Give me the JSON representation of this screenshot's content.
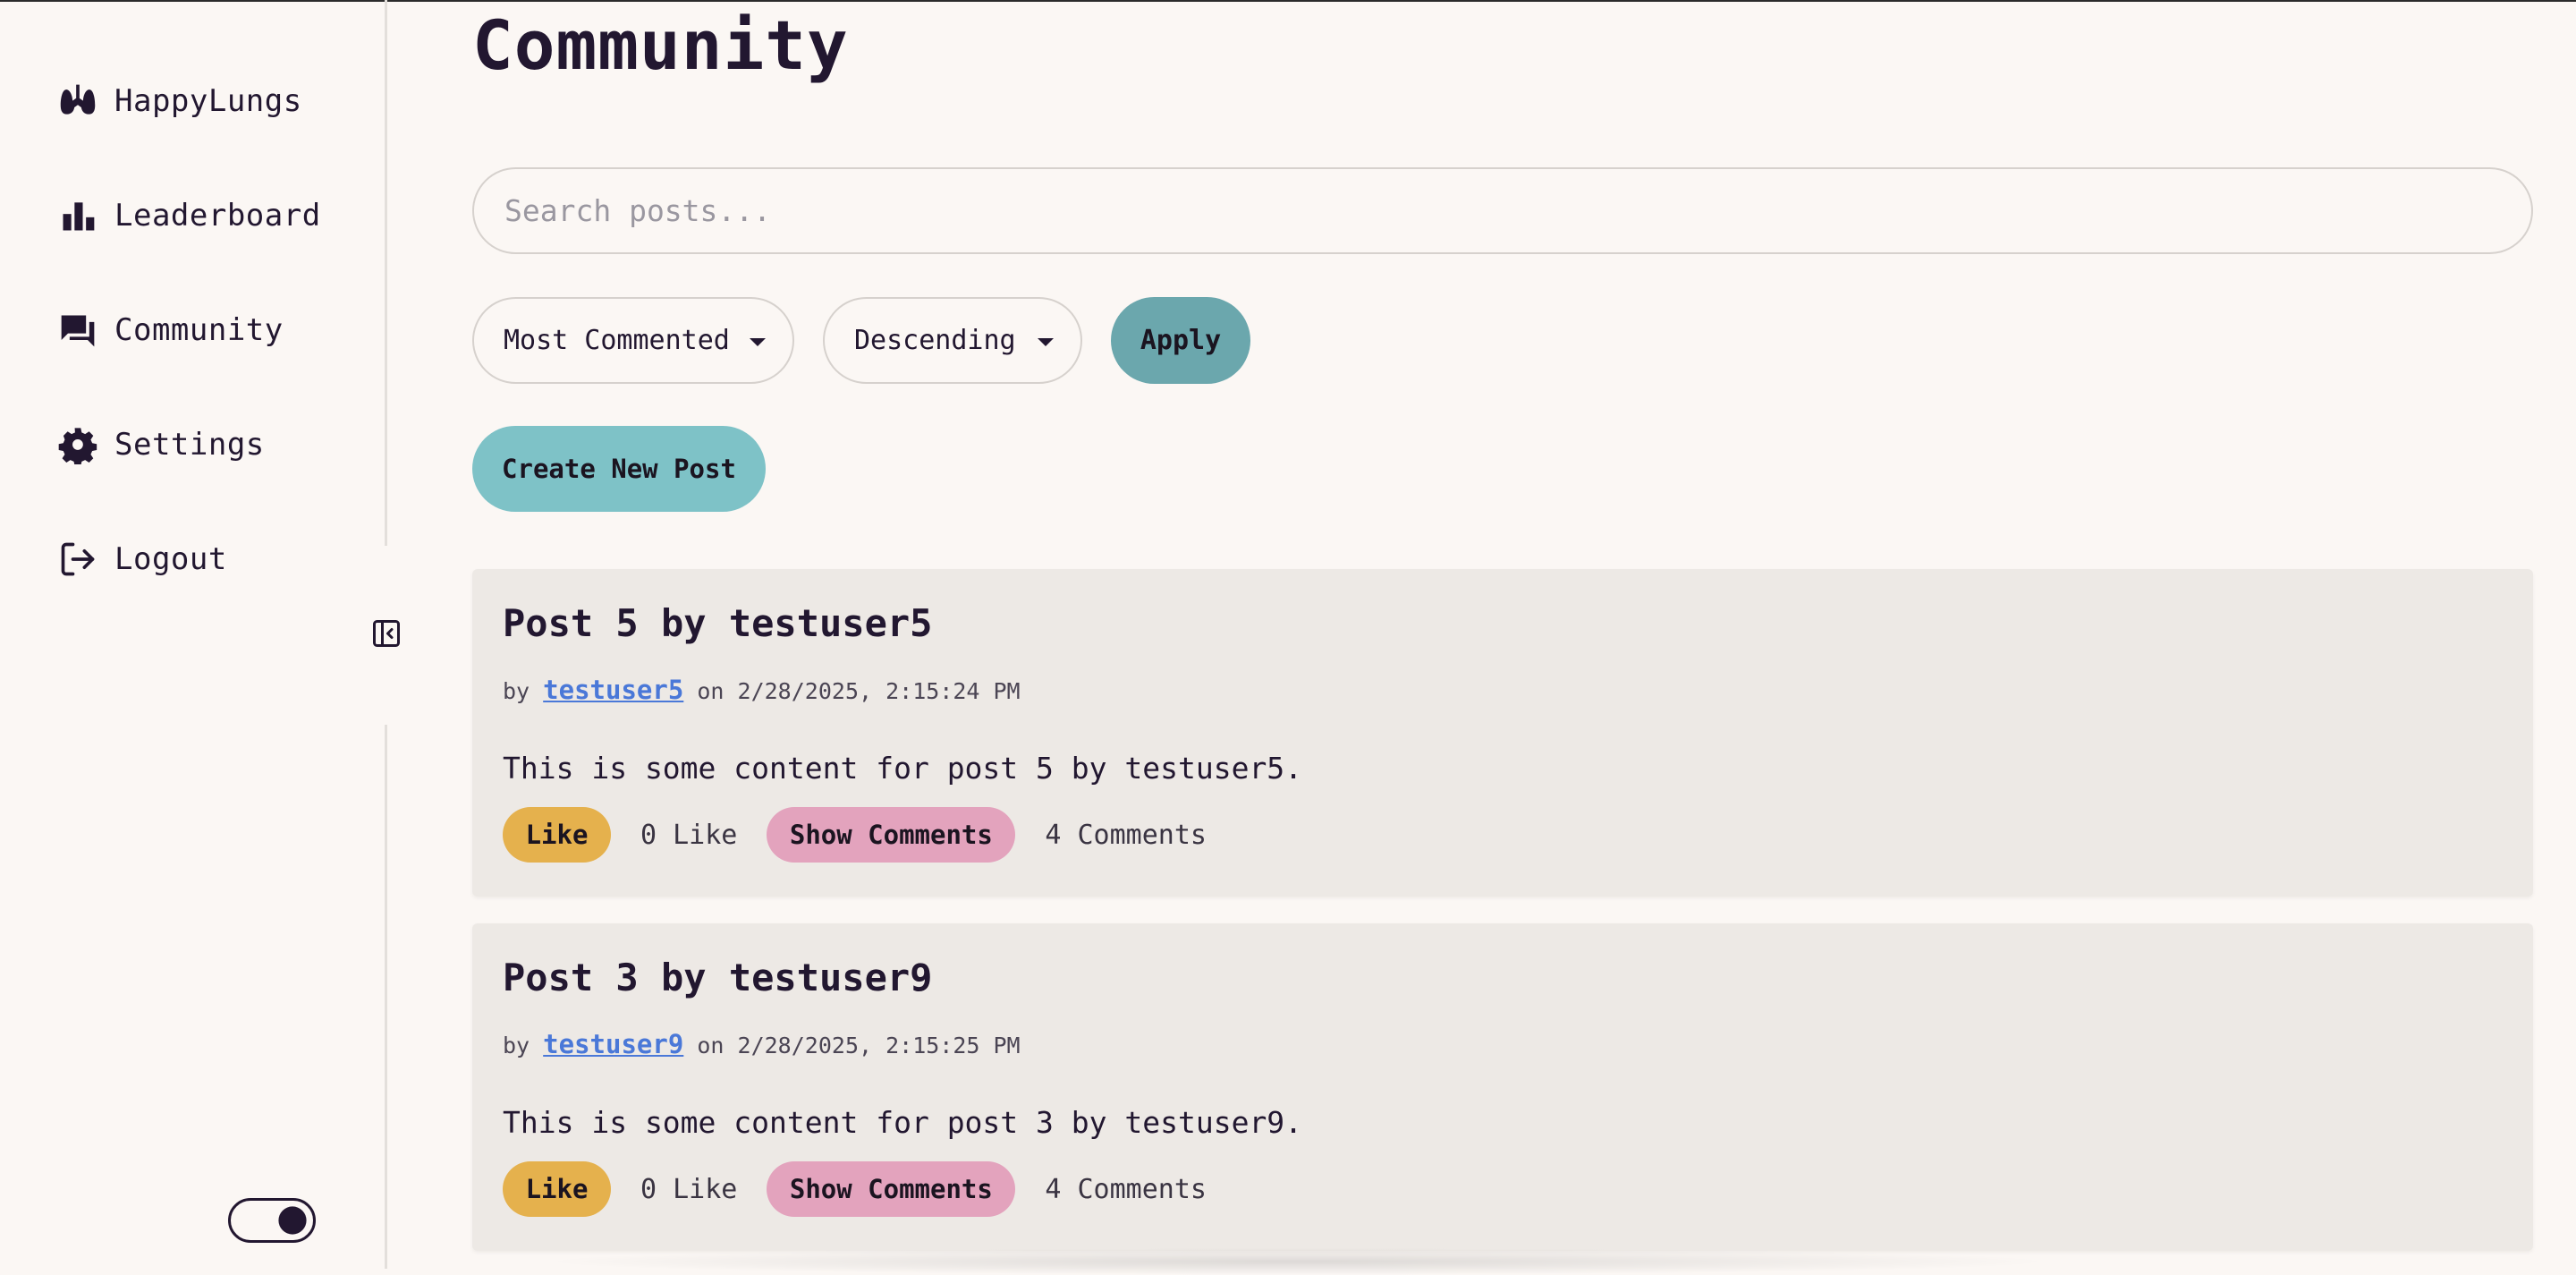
{
  "sidebar": {
    "items": [
      {
        "label": "HappyLungs",
        "icon": "lungs-icon"
      },
      {
        "label": "Leaderboard",
        "icon": "bar-chart-icon"
      },
      {
        "label": "Community",
        "icon": "chat-icon"
      },
      {
        "label": "Settings",
        "icon": "gear-icon"
      },
      {
        "label": "Logout",
        "icon": "logout-icon"
      }
    ],
    "collapse_icon": "collapse-sidebar-icon",
    "theme_toggle_icon": "moon-icon"
  },
  "main": {
    "title": "Community",
    "search": {
      "placeholder": "Search posts..."
    },
    "filters": {
      "sort_by": "Most Commented",
      "order": "Descending",
      "apply_label": "Apply"
    },
    "create_label": "Create New Post",
    "posts": [
      {
        "title": "Post 5 by testuser5",
        "by": "by",
        "author": "testuser5",
        "date": "on 2/28/2025, 2:15:24 PM",
        "content": "This is some content for post 5 by testuser5.",
        "like_label": "Like",
        "like_count": "0 Like",
        "comments_label": "Show Comments",
        "comment_count": "4 Comments"
      },
      {
        "title": "Post 3 by testuser9",
        "by": "by",
        "author": "testuser9",
        "date": "on 2/28/2025, 2:15:25 PM",
        "content": "This is some content for post 3 by testuser9.",
        "like_label": "Like",
        "like_count": "0 Like",
        "comments_label": "Show Comments",
        "comment_count": "4 Comments"
      }
    ]
  },
  "colors": {
    "background": "#fbf7f4",
    "text": "#221730",
    "apply": "#6ba7ad",
    "create": "#7ec2c7",
    "like": "#e5b14d",
    "comments": "#e3a3bd",
    "card": "#ede9e5",
    "link": "#4a78d8"
  }
}
